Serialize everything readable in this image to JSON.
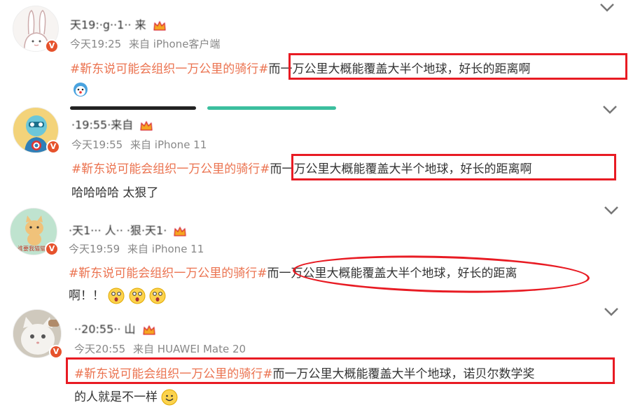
{
  "posts": [
    {
      "username": "天19:·g··1·· 来",
      "time": "今天19:25",
      "source": "来自 iPhone客户端",
      "hashtag": "#靳东说可能会组织一万公里的骑行#",
      "text": "而一万公里大概能覆盖大半个地球，好长的距离啊",
      "reply": ""
    },
    {
      "username": "·19:55·来自",
      "time": "今天19:55",
      "source": "来自 iPhone 11",
      "hashtag": "#靳东说可能会组织一万公里的骑行#",
      "text": "而一万公里大概能覆盖大半个地球，好长的距离啊",
      "reply": "哈哈哈哈 太狠了"
    },
    {
      "username": "·天1··· 人·· ·狠·天1·",
      "time": "今天19:59",
      "source": "来自 iPhone 11",
      "hashtag": "#靳东说可能会组织一万公里的骑行#",
      "text_line1": "而一万公里大概能覆盖大半个地球，好长的距离",
      "text_line2": "啊！！",
      "avatar_label": "谁要我猫猫猫"
    },
    {
      "username": "··20:55·· 山",
      "time": "今天20:55",
      "source": "来自 HUAWEI Mate 20",
      "hashtag": "#靳东说可能会组织一万公里的骑行#",
      "text_line1": "而一万公里大概能覆盖大半个地球，诺贝尔数学奖",
      "text_line2": "的人就是不一样"
    }
  ],
  "colors": {
    "hashtag": "#eb7350",
    "highlight": "#e81b23",
    "meta": "#888888",
    "verified": "#e6522c"
  },
  "icons": [
    "chevron-down-icon",
    "verified-badge-icon",
    "crown-icon",
    "astonished-emoji-icon",
    "smile-emoji-icon"
  ]
}
